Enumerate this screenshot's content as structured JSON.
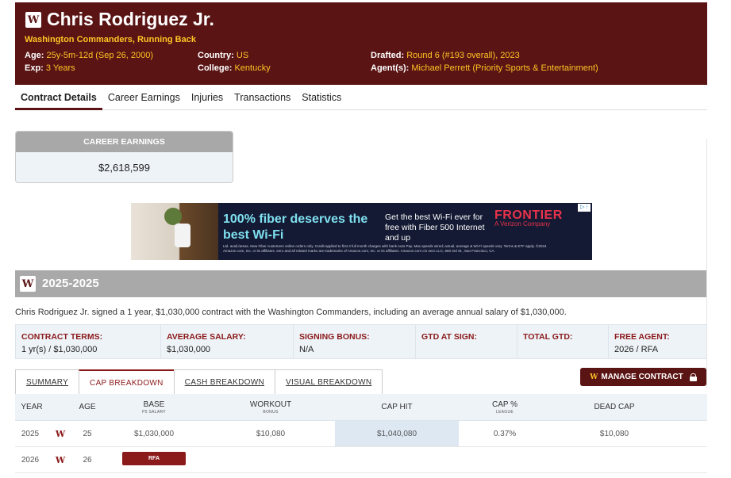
{
  "player": {
    "name": "Chris Rodriguez Jr.",
    "team_position": "Washington Commanders, Running Back",
    "logo_letter": "W",
    "age_label": "Age:",
    "age_value": "25y-5m-12d (Sep 26, 2000)",
    "exp_label": "Exp:",
    "exp_value": "3 Years",
    "country_label": "Country:",
    "country_value": "US",
    "college_label": "College:",
    "college_value": "Kentucky",
    "drafted_label": "Drafted:",
    "drafted_value": "Round 6 (#193 overall), 2023",
    "agent_label": "Agent(s):",
    "agent_value": "Michael Perrett (Priority Sports & Entertainment)"
  },
  "tabs": [
    "Contract Details",
    "Career Earnings",
    "Injuries",
    "Transactions",
    "Statistics"
  ],
  "career_earnings": {
    "label": "CAREER EARNINGS",
    "value": "$2,618,599"
  },
  "ad": {
    "headline": "100% fiber deserves the best Wi-Fi",
    "body": "Get the best Wi-Fi ever for free with Fiber 500 Internet and up",
    "brand": "FRONTIER",
    "brand_sub": "A Verizon Company",
    "fine_print": "Ltd. avail./areas. New Fiber customers online orders only. Credit applied to first 3 full month charges with bank Auto Pay. Max speeds wired; actual, average & Wi-Fi speeds vary. Terms & ETF apply. ©2024 Amazon.com, Inc. or its affiliates. eero and all related marks are trademarks of Amazon.com, Inc. or its affiliates. Amazon.com c/o eero LLC, 660 3rd St., San Francisco, CA.",
    "ad_marker": "▷ ⁝"
  },
  "contract": {
    "section_title": "2025-2025",
    "description": "Chris Rodriguez Jr. signed a 1 year, $1,030,000 contract with the Washington Commanders, including an average annual salary of $1,030,000.",
    "terms": [
      {
        "label": "CONTRACT TERMS:",
        "value": "1 yr(s) / $1,030,000"
      },
      {
        "label": "AVERAGE SALARY:",
        "value": "$1,030,000"
      },
      {
        "label": "SIGNING BONUS:",
        "value": "N/A"
      },
      {
        "label": "GTD AT SIGN:",
        "value": ""
      },
      {
        "label": "TOTAL GTD:",
        "value": ""
      },
      {
        "label": "FREE AGENT:",
        "value": "2026 / RFA"
      }
    ]
  },
  "subtabs": [
    "SUMMARY",
    "CAP BREAKDOWN",
    "CASH BREAKDOWN",
    "VISUAL BREAKDOWN"
  ],
  "manage_button": {
    "logo": "W",
    "label": "MANAGE CONTRACT"
  },
  "table": {
    "headers": {
      "year": "YEAR",
      "age": "AGE",
      "base": "BASE",
      "base_sub": "P5 SALARY",
      "workout": "WORKOUT",
      "workout_sub": "BONUS",
      "cap_hit": "CAP HIT",
      "cap_pct": "CAP %",
      "cap_pct_sub": "LEAGUE",
      "dead_cap": "DEAD CAP"
    },
    "rows": [
      {
        "year": "2025",
        "logo": "W",
        "age": "25",
        "base": "$1,030,000",
        "workout": "$10,080",
        "cap_hit": "$1,040,080",
        "cap_pct": "0.37%",
        "dead_cap": "$10,080"
      },
      {
        "year": "2026",
        "logo": "W",
        "age": "26",
        "badge": "RFA"
      }
    ]
  }
}
